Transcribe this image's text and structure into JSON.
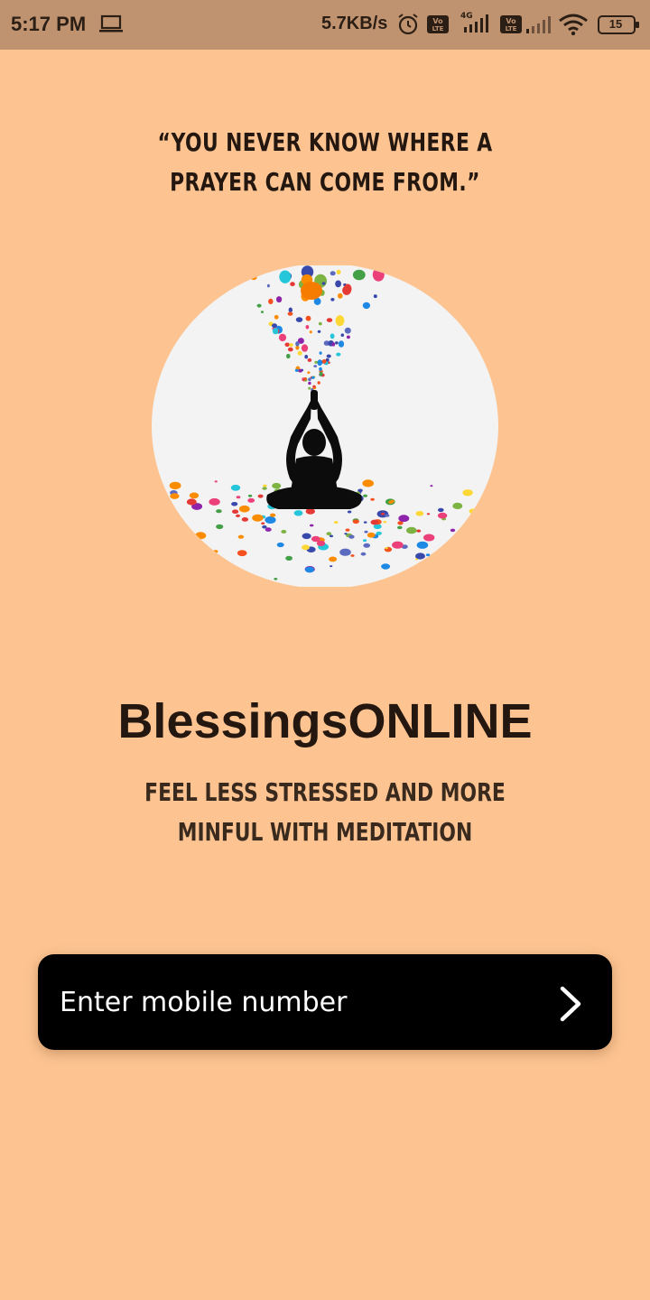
{
  "status_bar": {
    "time": "5:17 PM",
    "network_speed": "5.7KB/s",
    "network_type": "4G",
    "volte_label": "Vo LTE",
    "battery_level": "15",
    "icons": [
      "laptop-icon",
      "alarm-icon",
      "volte-icon",
      "signal-icon",
      "wifi-icon",
      "battery-icon"
    ]
  },
  "quote": "“YOU NEVER KNOW WHERE A PRAYER CAN COME FROM.”",
  "hero": {
    "image": "meditation-illustration"
  },
  "app_name": "BlessingsONLINE",
  "tagline": "FEEL LESS STRESSED AND MORE MINFUL WITH MEDITATION",
  "login": {
    "placeholder": "Enter mobile number",
    "value": "",
    "submit_icon": "chevron-right-icon"
  },
  "colors": {
    "background": "#fdc492",
    "status_bar": "#c09370",
    "input_bar": "#000000",
    "text_dark": "#231710"
  }
}
